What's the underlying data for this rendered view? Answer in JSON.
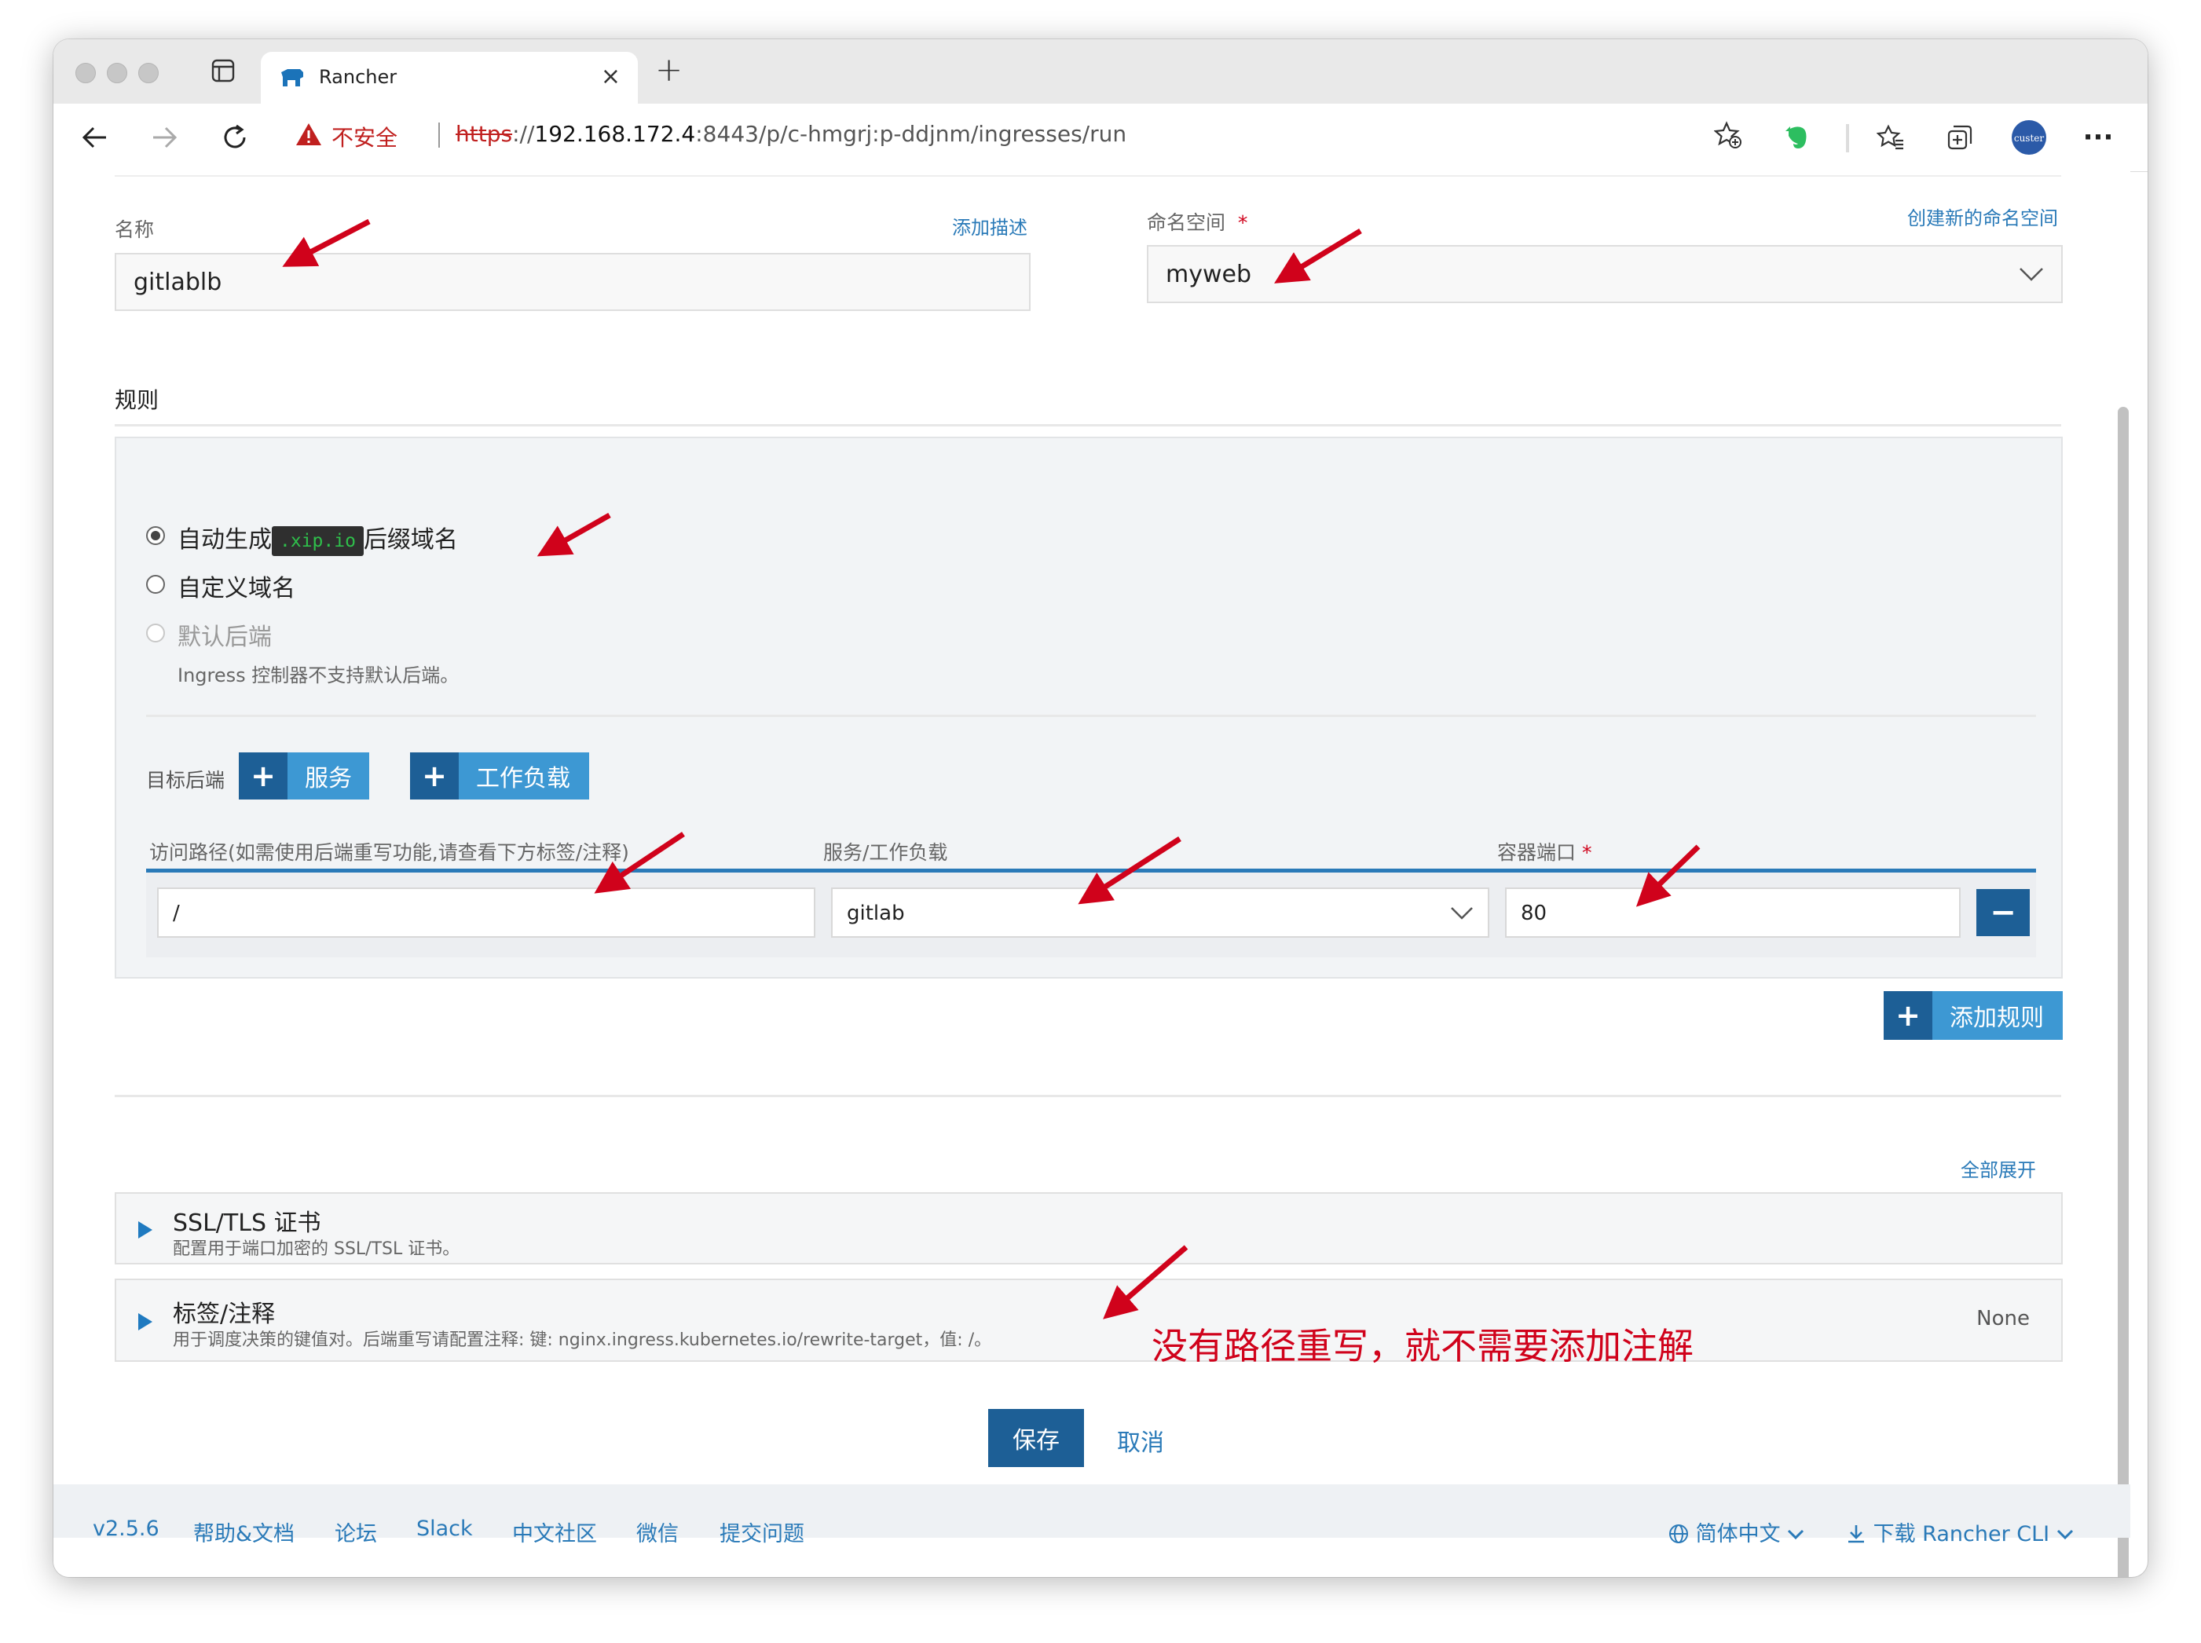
{
  "browser": {
    "tab_title": "Rancher",
    "insecure_label": "不安全",
    "url_scheme": "https",
    "url_sep": "://",
    "url_host": "192.168.172.4",
    "url_path": ":8443/p/c-hmgrj:p-ddjnm/ingresses/run",
    "profile_text": "custer"
  },
  "form": {
    "name_label": "名称",
    "add_description": "添加描述",
    "name_value": "gitlablb",
    "namespace_label": "命名空间",
    "required_mark": "*",
    "create_namespace": "创建新的命名空间",
    "namespace_value": "myweb"
  },
  "rules": {
    "title": "规则",
    "radio_auto_prefix": "自动生成",
    "radio_auto_code": ".xip.io",
    "radio_auto_suffix": "后缀域名",
    "radio_custom": "自定义域名",
    "radio_default": "默认后端",
    "default_note": "Ingress 控制器不支持默认后端。",
    "target_label": "目标后端",
    "service_button": "服务",
    "workload_button": "工作负载",
    "col_path": "访问路径(如需使用后端重写功能,请查看下方标签/注释)",
    "col_service": "服务/工作负载",
    "col_port": "容器端口",
    "row_path": "/",
    "row_service": "gitlab",
    "row_port": "80",
    "add_rule": "添加规则"
  },
  "sections": {
    "expand_all": "全部展开",
    "ssl_title": "SSL/TLS 证书",
    "ssl_desc": "配置用于端口加密的 SSL/TSL 证书。",
    "labels_title": "标签/注释",
    "labels_desc": "用于调度决策的键值对。后端重写请配置注释: 键: nginx.ingress.kubernetes.io/rewrite-target，值: /。",
    "labels_status": "None"
  },
  "actions": {
    "save": "保存",
    "cancel": "取消"
  },
  "annotation_text": "没有路径重写，就不需要添加注解",
  "footer": {
    "version": "v2.5.6",
    "docs": "帮助&文档",
    "forum": "论坛",
    "slack": "Slack",
    "community": "中文社区",
    "wechat": "微信",
    "issue": "提交问题",
    "language": "简体中文",
    "download": "下载 Rancher CLI"
  },
  "colors": {
    "accent": "#1d5f96",
    "button": "#3d98d3",
    "link": "#2a7ab8",
    "warning": "#d0021b"
  }
}
